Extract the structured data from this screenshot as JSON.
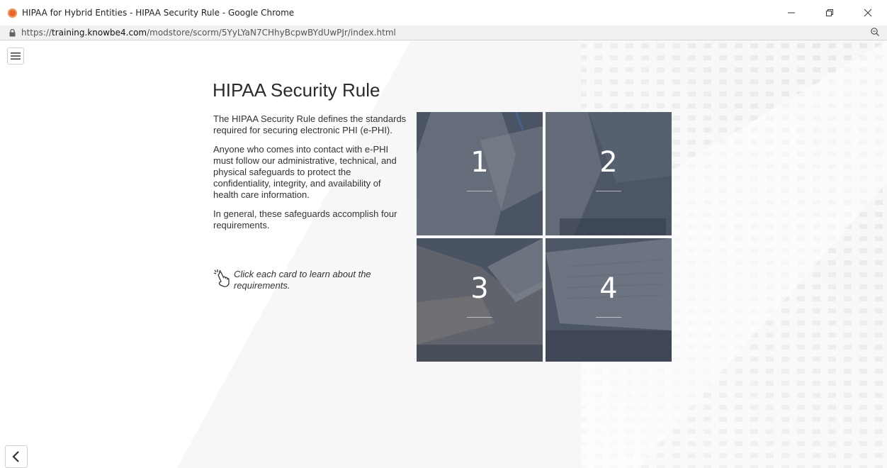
{
  "window": {
    "title": "HIPAA for Hybrid Entities - HIPAA Security Rule - Google Chrome",
    "url_scheme": "https://",
    "url_host": "training.knowbe4.com",
    "url_path": "/modstore/scorm/5YyLYaN7CHhyBcpwBYdUwPJr/index.html"
  },
  "main": {
    "title": "HIPAA Security Rule",
    "paragraphs": [
      "The HIPAA Security Rule defines the standards required for securing electronic PHI (e-PHI).",
      "Anyone who comes into contact with e-PHI must follow our administrative, technical, and physical safeguards to protect the confidentiality, integrity, and availability of health care information.",
      "In general, these safeguards accomplish four requirements."
    ],
    "hint": "Click each card to learn about the requirements."
  },
  "cards": [
    {
      "label": "1"
    },
    {
      "label": "2"
    },
    {
      "label": "3"
    },
    {
      "label": "4"
    }
  ],
  "icons": {
    "menu": "hamburger-icon",
    "back": "chevron-left-icon",
    "hint": "hand-pointer-click-icon",
    "lock": "lock-icon",
    "zoom": "magnifier-icon"
  },
  "colors": {
    "favicon": "#e8642c",
    "card_overlay": "#3c4656"
  }
}
